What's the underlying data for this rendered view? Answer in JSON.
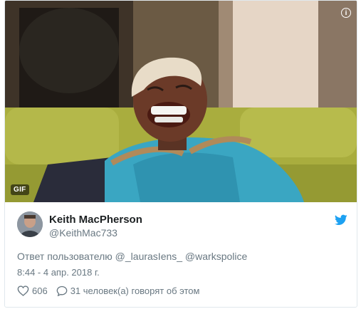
{
  "media": {
    "badge": "GIF",
    "info_label": "i"
  },
  "author": {
    "name": "Keith MacPherson",
    "handle": "@KeithMac733"
  },
  "tweet": {
    "reply_to": "Ответ пользователю @_laurasIens_ @warkspolice",
    "timestamp": "8:44 - 4 апр. 2018 г."
  },
  "actions": {
    "likes": "606",
    "replies": "31 человек(а) говорят об этом"
  },
  "colors": {
    "twitter_blue": "#1da1f2",
    "text_secondary": "#697882",
    "text_primary": "#1c2022"
  },
  "icons": {
    "info": "info-icon",
    "bird": "twitter-bird-icon",
    "heart": "heart-icon",
    "reply": "speech-bubble-icon"
  }
}
